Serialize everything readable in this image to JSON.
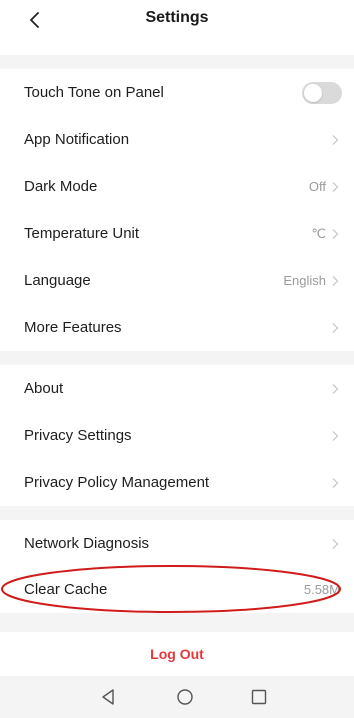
{
  "header": {
    "title": "Settings",
    "back_icon": "chevron-left-icon"
  },
  "colors": {
    "divider": "#f4f4f4",
    "accent_red": "#e4383b",
    "value_gray": "#9b9b9b",
    "annotation_red": "#d01b1b"
  },
  "section1": [
    {
      "label": "Touch Tone on Panel",
      "control": "toggle",
      "toggle_on": false
    },
    {
      "label": "App Notification",
      "value": ""
    },
    {
      "label": "Dark Mode",
      "value": "Off"
    },
    {
      "label": "Temperature Unit",
      "value": "℃"
    },
    {
      "label": "Language",
      "value": "English"
    },
    {
      "label": "More Features",
      "value": ""
    }
  ],
  "section2": [
    {
      "label": "About",
      "value": ""
    },
    {
      "label": "Privacy Settings",
      "value": ""
    },
    {
      "label": "Privacy Policy Management",
      "value": ""
    }
  ],
  "section3": [
    {
      "label": "Network Diagnosis",
      "value": ""
    },
    {
      "label": "Clear Cache",
      "value": "5.58M"
    }
  ],
  "logout_label": "Log Out",
  "navbar": {
    "back_icon": "triangle-back-icon",
    "home_icon": "circle-home-icon",
    "recents_icon": "square-recents-icon"
  }
}
